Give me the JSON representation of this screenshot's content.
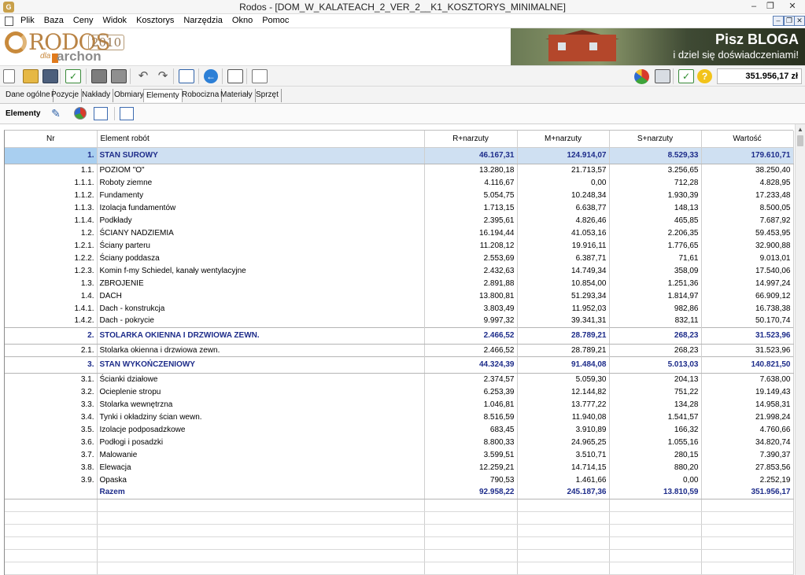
{
  "window": {
    "title": "Rodos - [DOM_W_KALATEACH_2_VER_2__K1_KOSZTORYS_MINIMALNE]",
    "minimize": "–",
    "restore": "❐",
    "close": "✕"
  },
  "menu": [
    "Plik",
    "Baza",
    "Ceny",
    "Widok",
    "Kosztorys",
    "Narzędzia",
    "Okno",
    "Pomoc"
  ],
  "logo": {
    "name": "RODOS",
    "year": "2010",
    "dla": "dla",
    "partner": "archon"
  },
  "ad": {
    "title": "Pisz BLOGA",
    "subtitle": "i dziel się doświadczeniami!"
  },
  "toolbar": {
    "total": "351.956,17 zł"
  },
  "tabs": [
    "Dane ogólne",
    "Pozycje",
    "Nakłady",
    "Obmiary",
    "Elementy",
    "Robocizna",
    "Materiały",
    "Sprzęt"
  ],
  "active_tab": "Elementy",
  "section": {
    "label": "Elementy"
  },
  "table": {
    "headers": [
      "Nr",
      "Element robót",
      "R+narzuty",
      "M+narzuty",
      "S+narzuty",
      "Wartość"
    ],
    "rows": [
      {
        "nr": "1.",
        "name": "STAN SUROWY",
        "r": "46.167,31",
        "m": "124.914,07",
        "s": "8.529,33",
        "w": "179.610,71",
        "type": "section",
        "selected": true
      },
      {
        "nr": "1.1.",
        "name": "POZIOM \"O\"",
        "r": "13.280,18",
        "m": "21.713,57",
        "s": "3.256,65",
        "w": "38.250,40"
      },
      {
        "nr": "1.1.1.",
        "name": "Roboty ziemne",
        "r": "4.116,67",
        "m": "0,00",
        "s": "712,28",
        "w": "4.828,95"
      },
      {
        "nr": "1.1.2.",
        "name": "Fundamenty",
        "r": "5.054,75",
        "m": "10.248,34",
        "s": "1.930,39",
        "w": "17.233,48"
      },
      {
        "nr": "1.1.3.",
        "name": "Izolacja fundamentów",
        "r": "1.713,15",
        "m": "6.638,77",
        "s": "148,13",
        "w": "8.500,05"
      },
      {
        "nr": "1.1.4.",
        "name": "Podkłady",
        "r": "2.395,61",
        "m": "4.826,46",
        "s": "465,85",
        "w": "7.687,92"
      },
      {
        "nr": "1.2.",
        "name": "ŚCIANY NADZIEMIA",
        "r": "16.194,44",
        "m": "41.053,16",
        "s": "2.206,35",
        "w": "59.453,95"
      },
      {
        "nr": "1.2.1.",
        "name": "Ściany parteru",
        "r": "11.208,12",
        "m": "19.916,11",
        "s": "1.776,65",
        "w": "32.900,88"
      },
      {
        "nr": "1.2.2.",
        "name": "Ściany poddasza",
        "r": "2.553,69",
        "m": "6.387,71",
        "s": "71,61",
        "w": "9.013,01"
      },
      {
        "nr": "1.2.3.",
        "name": "Komin f-my Schiedel, kanały wentylacyjne",
        "r": "2.432,63",
        "m": "14.749,34",
        "s": "358,09",
        "w": "17.540,06"
      },
      {
        "nr": "1.3.",
        "name": "ZBROJENIE",
        "r": "2.891,88",
        "m": "10.854,00",
        "s": "1.251,36",
        "w": "14.997,24"
      },
      {
        "nr": "1.4.",
        "name": "DACH",
        "r": "13.800,81",
        "m": "51.293,34",
        "s": "1.814,97",
        "w": "66.909,12"
      },
      {
        "nr": "1.4.1.",
        "name": "Dach - konstrukcja",
        "r": "3.803,49",
        "m": "11.952,03",
        "s": "982,86",
        "w": "16.738,38"
      },
      {
        "nr": "1.4.2.",
        "name": "Dach - pokrycie",
        "r": "9.997,32",
        "m": "39.341,31",
        "s": "832,11",
        "w": "50.170,74"
      },
      {
        "nr": "2.",
        "name": "STOLARKA OKIENNA I DRZWIOWA ZEWN.",
        "r": "2.466,52",
        "m": "28.789,21",
        "s": "268,23",
        "w": "31.523,96",
        "type": "section"
      },
      {
        "nr": "2.1.",
        "name": "Stolarka okienna i drzwiowa zewn.",
        "r": "2.466,52",
        "m": "28.789,21",
        "s": "268,23",
        "w": "31.523,96"
      },
      {
        "nr": "3.",
        "name": "STAN WYKOŃCZENIOWY",
        "r": "44.324,39",
        "m": "91.484,08",
        "s": "5.013,03",
        "w": "140.821,50",
        "type": "section"
      },
      {
        "nr": "3.1.",
        "name": "Ścianki działowe",
        "r": "2.374,57",
        "m": "5.059,30",
        "s": "204,13",
        "w": "7.638,00"
      },
      {
        "nr": "3.2.",
        "name": "Ocieplenie stropu",
        "r": "6.253,39",
        "m": "12.144,82",
        "s": "751,22",
        "w": "19.149,43"
      },
      {
        "nr": "3.3.",
        "name": "Stolarka wewnętrzna",
        "r": "1.046,81",
        "m": "13.777,22",
        "s": "134,28",
        "w": "14.958,31"
      },
      {
        "nr": "3.4.",
        "name": "Tynki i okładziny ścian wewn.",
        "r": "8.516,59",
        "m": "11.940,08",
        "s": "1.541,57",
        "w": "21.998,24"
      },
      {
        "nr": "3.5.",
        "name": "Izolacje podposadzkowe",
        "r": "683,45",
        "m": "3.910,89",
        "s": "166,32",
        "w": "4.760,66"
      },
      {
        "nr": "3.6.",
        "name": "Podłogi i posadzki",
        "r": "8.800,33",
        "m": "24.965,25",
        "s": "1.055,16",
        "w": "34.820,74"
      },
      {
        "nr": "3.7.",
        "name": "Malowanie",
        "r": "3.599,51",
        "m": "3.510,71",
        "s": "280,15",
        "w": "7.390,37"
      },
      {
        "nr": "3.8.",
        "name": "Elewacja",
        "r": "12.259,21",
        "m": "14.714,15",
        "s": "880,20",
        "w": "27.853,56"
      },
      {
        "nr": "3.9.",
        "name": "Opaska",
        "r": "790,53",
        "m": "1.461,66",
        "s": "0,00",
        "w": "2.252,19"
      },
      {
        "nr": "",
        "name": "Razem",
        "r": "92.958,22",
        "m": "245.187,36",
        "s": "13.810,59",
        "w": "351.956,17",
        "type": "total"
      }
    ]
  },
  "colors": {
    "section_text": "#1d2c8a",
    "selected_row": "#cfe0f2",
    "selected_cell": "#a9cff0"
  }
}
